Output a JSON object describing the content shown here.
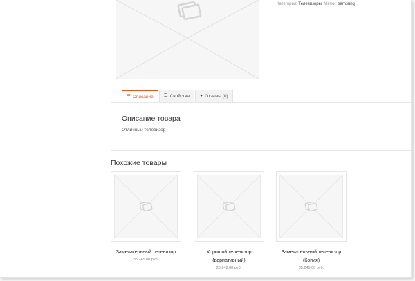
{
  "meta": {
    "category_label": "Категория:",
    "category_value": "Телевизоры",
    "tags_label": "Метки:",
    "tags_value": "samsung"
  },
  "tabs": [
    {
      "label": "Описание",
      "icon": "list-icon",
      "active": true
    },
    {
      "label": "Свойства",
      "icon": "list-icon",
      "active": false
    },
    {
      "label": "Отзывы (0)",
      "icon": "comment-icon",
      "active": false
    }
  ],
  "description": {
    "title": "Описание товара",
    "text": "Отличный телевизор"
  },
  "related": {
    "title": "Похожие товары",
    "products": [
      {
        "name": "Замечательный телевизор",
        "price": "35,245.00 руб."
      },
      {
        "name": "Хороший телевизор (вариативный)",
        "price": "25,242.00 руб."
      },
      {
        "name": "Замечательный телевизор (Копия)",
        "price": "35,245.00 руб."
      }
    ]
  },
  "colors": {
    "accent": "#e8581a",
    "placeholder_bg": "#f6f6f6",
    "border": "#e6e6e6"
  }
}
